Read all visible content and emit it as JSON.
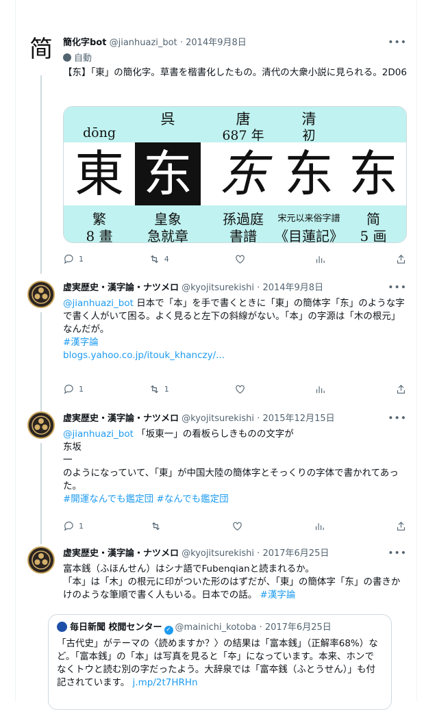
{
  "tweets": [
    {
      "name": "簡化字bot",
      "handle": "@jianhuazi_bot",
      "date": "2014年9月8日",
      "avatar_char": "简",
      "auto_label": "自動",
      "text": "【东】「東」の簡化字。草書を楷書化したもの。清代の大衆小説に見られる。2D06",
      "replies": "1",
      "retweets": "4",
      "likes": "",
      "views": ""
    },
    {
      "name": "虚実歴史・漢字論・ナツメロ",
      "handle": "@kyojitsurekishi",
      "date": "2014年9月8日",
      "mention": "@jianhuazi_bot",
      "text": " 日本で「本」を手で書くときに「東」の簡体字「东」のような字で書く人がいて困る。よく見ると左下の斜線がない。「本」の字源は「木の根元」なんだが。",
      "hashtag": "#漢字論",
      "url": "blogs.yahoo.co.jp/itouk_khanczy/...",
      "replies": "1",
      "retweets": "1",
      "likes": "",
      "views": ""
    },
    {
      "name": "虚実歴史・漢字論・ナツメロ",
      "handle": "@kyojitsurekishi",
      "date": "2015年12月15日",
      "mention": "@jianhuazi_bot",
      "line1": " 「坂東一」の看板らしきものの文字が",
      "line2": "东坂",
      "line3": "一",
      "line4": "のようになっていて、「東」が中国大陸の簡体字とそっくりの字体で書かれてあった。",
      "hashtags": "#開運なんでも鑑定団 #なんでも鑑定団",
      "replies": "1",
      "retweets": "",
      "likes": "",
      "views": ""
    },
    {
      "name": "虚実歴史・漢字論・ナツメロ",
      "handle": "@kyojitsurekishi",
      "date": "2017年6月25日",
      "line1": "富本銭（ふほんせん）はシナ語でFubenqianと読まれるか。",
      "line2": "「本」は「木」の根元に印がついた形のはずだが、「東」の簡体字「东」の書きかけのような筆順で書く人もいる。日本での話。",
      "hashtag": "#漢字論"
    }
  ],
  "image": {
    "top_row": [
      "呉",
      "唐",
      "清"
    ],
    "second_row": [
      "dōng",
      "687 年",
      "初"
    ],
    "glyphs": [
      "東",
      "东",
      "东",
      "东",
      "东"
    ],
    "bottom_row1": [
      "繁",
      "皇象",
      "孫過庭",
      "宋元以来俗字譜",
      "简"
    ],
    "bottom_row2": [
      "8 畫",
      "急就章",
      "書譜",
      "《目蓮記》",
      "5 画"
    ]
  },
  "quote": {
    "name": "毎日新聞 校閲センター",
    "handle": "@mainichi_kotoba",
    "date": "2017年6月25日",
    "text": "「古代史」がテーマの〈読めますか？〉の結果は「富本銭」（正解率68%）など。「富本銭」の「本」は写真を見ると「夲」になっています。本来、ホンでなくトウと読む別の字だったよう。大辞泉では「富夲銭（ふとうせん）」も付記されています。",
    "link": "j.mp/2t7HRHn"
  },
  "colors": {
    "link": "#1d9bf0",
    "band": "#bff2f0"
  }
}
